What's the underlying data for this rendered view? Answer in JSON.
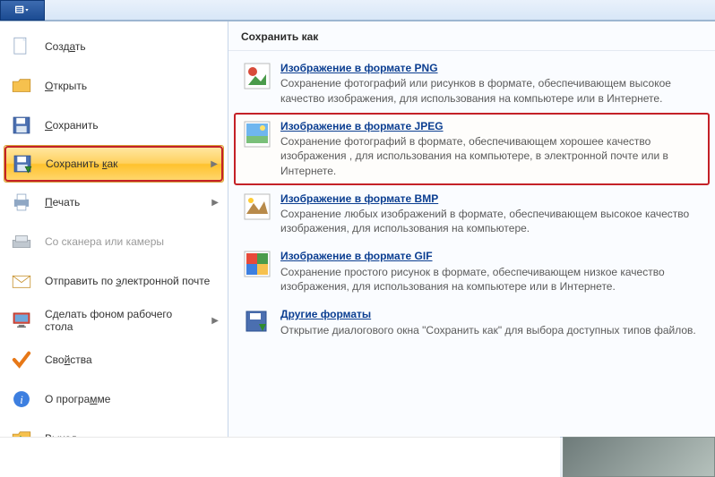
{
  "ribbon": {
    "app_icon": "app-menu-icon"
  },
  "menu": {
    "items": [
      {
        "key": "create",
        "label_pre": "Созд",
        "u": "а",
        "label_post": "ть",
        "icon": "page-icon",
        "has_caret": false,
        "disabled": false
      },
      {
        "key": "open",
        "label_pre": "",
        "u": "О",
        "label_post": "ткрыть",
        "icon": "folder-icon",
        "has_caret": false,
        "disabled": false
      },
      {
        "key": "save",
        "label_pre": "",
        "u": "С",
        "label_post": "охранить",
        "icon": "floppy-icon",
        "has_caret": false,
        "disabled": false
      },
      {
        "key": "saveas",
        "label_pre": "Сохранить ",
        "u": "к",
        "label_post": "ак",
        "icon": "floppy-arrow-icon",
        "has_caret": true,
        "disabled": false,
        "active": true
      },
      {
        "key": "print",
        "label_pre": "",
        "u": "П",
        "label_post": "ечать",
        "icon": "printer-icon",
        "has_caret": true,
        "disabled": false
      },
      {
        "key": "scanner",
        "label_pre": "Со скане",
        "u": "",
        "label_post": "ра или камеры",
        "icon": "scanner-icon",
        "has_caret": false,
        "disabled": true
      },
      {
        "key": "email",
        "label_pre": "Отправить по ",
        "u": "э",
        "label_post": "лектронной почте",
        "icon": "envelope-icon",
        "has_caret": false,
        "disabled": false
      },
      {
        "key": "desktop",
        "label_pre": "Сделать фоном рабочего сто",
        "u": "",
        "label_post": "ла",
        "icon": "monitor-icon",
        "has_caret": true,
        "disabled": false
      },
      {
        "key": "props",
        "label_pre": "Сво",
        "u": "й",
        "label_post": "ства",
        "icon": "check-icon",
        "has_caret": false,
        "disabled": false
      },
      {
        "key": "about",
        "label_pre": "О програ",
        "u": "м",
        "label_post": "ме",
        "icon": "info-icon",
        "has_caret": false,
        "disabled": false
      },
      {
        "key": "exit",
        "label_pre": "В",
        "u": "ы",
        "label_post": "ход",
        "icon": "exit-icon",
        "has_caret": false,
        "disabled": false
      }
    ]
  },
  "panel": {
    "title": "Сохранить как",
    "formats": [
      {
        "key": "png",
        "title_pre": "Изобра",
        "u": "ж",
        "title_post": "ение в формате PNG",
        "desc": "Сохранение фотографий или рисунков в формате, обеспечивающем высокое качество изображения, для использования на компьютере или в Интернете.",
        "thumb": "png-thumb",
        "highlight": false
      },
      {
        "key": "jpeg",
        "title_pre": "Изобра",
        "u": "ж",
        "title_post": "ение в формате JPEG",
        "desc": "Сохранение фотографий в формате, обеспечивающем хорошее качество изображения , для использования на компьютере, в электронной почте или в Интернете.",
        "thumb": "jpeg-thumb",
        "highlight": true
      },
      {
        "key": "bmp",
        "title_pre": "Изображение в формате ",
        "u": "B",
        "title_post": "MP",
        "desc": "Сохранение любых изображений в формате, обеспечивающем высокое качество изображения, для использования на компьютере.",
        "thumb": "bmp-thumb",
        "highlight": false
      },
      {
        "key": "gif",
        "title_pre": "И",
        "u": "з",
        "title_post": "ображение в формате GIF",
        "desc": "Сохранение простого рисунок в формате, обеспечивающем низкое качество изображения, для использования на компьютере или в Интернете.",
        "thumb": "gif-thumb",
        "highlight": false
      },
      {
        "key": "other",
        "title_pre": "",
        "u": "Д",
        "title_post": "ругие форматы",
        "desc": "Открытие диалогового окна \"Сохранить как\" для выбора доступных типов файлов.",
        "thumb": "other-thumb",
        "highlight": false
      }
    ]
  }
}
